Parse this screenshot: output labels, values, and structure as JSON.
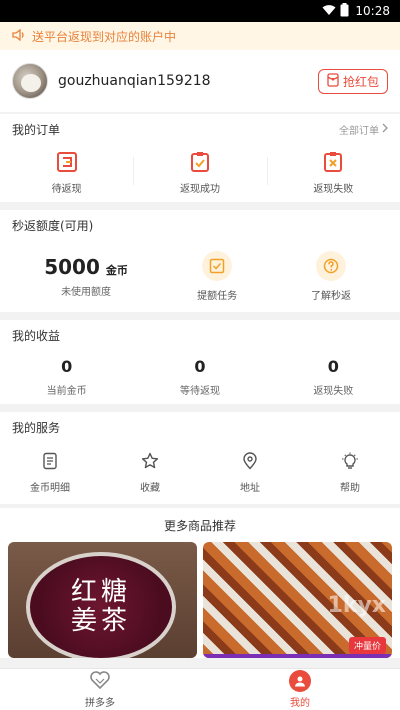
{
  "status_bar": {
    "time": "10:28",
    "wifi_icon": "wifi-icon",
    "battery_icon": "battery-icon"
  },
  "notice": {
    "icon": "speaker-icon",
    "text": "送平台返现到对应的账户中"
  },
  "profile": {
    "username": "gouzhuanqian159218",
    "redpack_label": "抢红包",
    "redpack_icon": "red-envelope-icon"
  },
  "orders": {
    "title": "我的订单",
    "all_label": "全部订单",
    "items": [
      {
        "label": "待返现",
        "icon": "pending-cashback-icon"
      },
      {
        "label": "返现成功",
        "icon": "cashback-success-icon"
      },
      {
        "label": "返现失败",
        "icon": "cashback-failed-icon"
      }
    ]
  },
  "quota": {
    "title": "秒返额度(可用)",
    "amount": "5000",
    "unit": "金币",
    "sub_label": "未使用额度",
    "actions": [
      {
        "label": "提额任务",
        "icon": "checkbox-task-icon"
      },
      {
        "label": "了解秒返",
        "icon": "question-icon"
      }
    ]
  },
  "income": {
    "title": "我的收益",
    "items": [
      {
        "value": "0",
        "label": "当前金币"
      },
      {
        "value": "0",
        "label": "等待返现"
      },
      {
        "value": "0",
        "label": "返现失败"
      }
    ]
  },
  "services": {
    "title": "我的服务",
    "items": [
      {
        "label": "金币明细",
        "icon": "document-icon"
      },
      {
        "label": "收藏",
        "icon": "star-icon"
      },
      {
        "label": "地址",
        "icon": "location-pin-icon"
      },
      {
        "label": "帮助",
        "icon": "lightbulb-icon"
      }
    ]
  },
  "recommend": {
    "title": "更多商品推荐",
    "products": [
      {
        "image_text_line1": "红糖",
        "image_text_line2": "姜茶"
      },
      {
        "tag": "冲量价",
        "watermark": "1kyx"
      }
    ]
  },
  "tabbar": {
    "items": [
      {
        "label": "拼多多",
        "icon": "heart-logo-icon",
        "active": false
      },
      {
        "label": "我的",
        "icon": "profile-icon",
        "active": true
      }
    ]
  },
  "colors": {
    "accent": "#e94b3c",
    "notice_text": "#e8823a",
    "notice_bg": "#fff6e6",
    "icon_orange": "#f0a128"
  }
}
